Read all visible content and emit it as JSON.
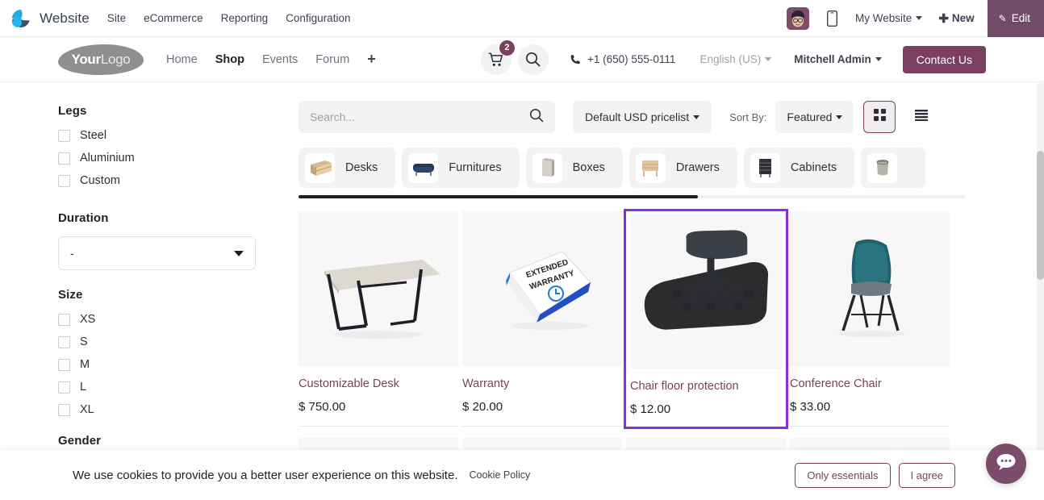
{
  "odoo_bar": {
    "app_name": "Website",
    "menus": [
      "Site",
      "eCommerce",
      "Reporting",
      "Configuration"
    ],
    "website_selector": "My Website",
    "new_label": "New",
    "edit_label": "Edit",
    "edit_bg": "#714b67"
  },
  "site_header": {
    "logo_bold": "Your",
    "logo_light": "Logo",
    "nav": [
      {
        "label": "Home",
        "active": false
      },
      {
        "label": "Shop",
        "active": true
      },
      {
        "label": "Events",
        "active": false
      },
      {
        "label": "Forum",
        "active": false
      }
    ],
    "nav_add": "+",
    "cart_count": "2",
    "phone": "+1 (650) 555-0111",
    "language": "English (US)",
    "user": "Mitchell Admin",
    "contact_label": "Contact Us",
    "brand_color": "#7b3f5f"
  },
  "sidebar": {
    "groups": [
      {
        "title": "Legs",
        "type": "checkbox",
        "options": [
          "Steel",
          "Aluminium",
          "Custom"
        ]
      },
      {
        "title": "Duration",
        "type": "select",
        "value": "-"
      },
      {
        "title": "Size",
        "type": "checkbox",
        "options": [
          "XS",
          "S",
          "M",
          "L",
          "XL"
        ]
      },
      {
        "title": "Gender",
        "type": "checkbox",
        "options": []
      }
    ]
  },
  "toolbar": {
    "search_placeholder": "Search...",
    "search_value": "",
    "pricelist": "Default USD pricelist",
    "sort_by_label": "Sort By:",
    "sort_value": "Featured",
    "view_grid": "grid-view-icon",
    "view_list": "list-view-icon"
  },
  "categories": [
    {
      "label": "Desks",
      "icon": "desk-thumbnail"
    },
    {
      "label": "Furnitures",
      "icon": "sofa-thumbnail"
    },
    {
      "label": "Boxes",
      "icon": "box-thumbnail"
    },
    {
      "label": "Drawers",
      "icon": "drawer-thumbnail"
    },
    {
      "label": "Cabinets",
      "icon": "cabinet-thumbnail"
    },
    {
      "label": "",
      "icon": "bin-thumbnail"
    }
  ],
  "products": [
    {
      "name": "Customizable Desk",
      "price": "$ 750.00",
      "image": "desk-photo",
      "selected": false
    },
    {
      "name": "Warranty",
      "price": "$ 20.00",
      "image": "warranty-box-photo",
      "selected": false
    },
    {
      "name": "Chair floor protection",
      "price": "$ 12.00",
      "image": "chair-mat-photo",
      "selected": true
    },
    {
      "name": "Conference Chair",
      "price": "$ 33.00",
      "image": "teal-chair-photo",
      "selected": false
    }
  ],
  "selection_highlight_color": "#8b2be2",
  "cookie_bar": {
    "message": "We use cookies to provide you a better user experience on this website.",
    "policy_link": "Cookie Policy",
    "only_essentials": "Only essentials",
    "agree": "I agree"
  },
  "chat": {
    "icon": "chat-bubble-icon"
  }
}
